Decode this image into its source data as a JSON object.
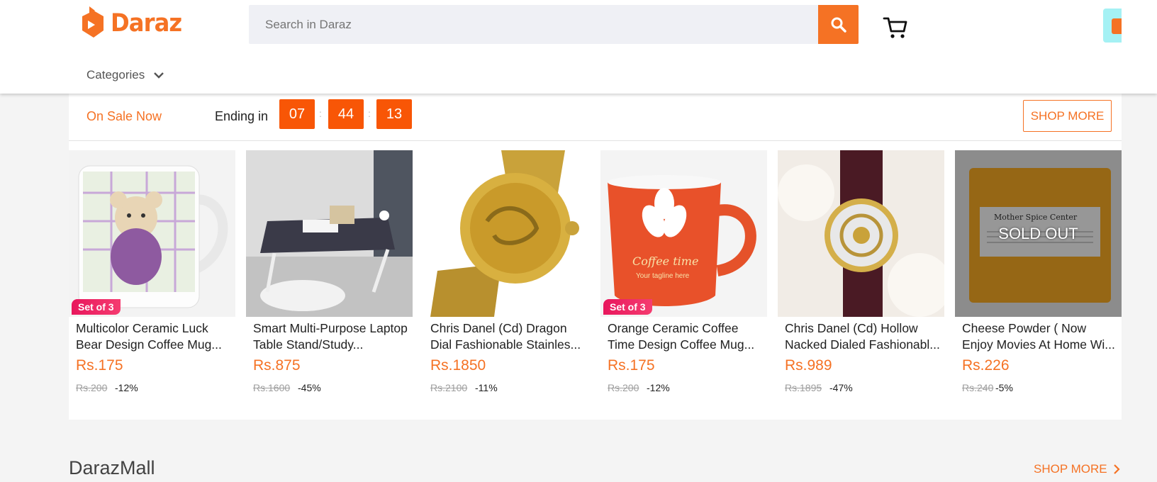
{
  "header": {
    "logo_text": "Daraz",
    "search_placeholder": "Search in Daraz",
    "categories_label": "Categories",
    "brand_color": "#f57224"
  },
  "flash_sale": {
    "on_sale_label": "On Sale Now",
    "ending_label": "Ending in",
    "timer": {
      "hours": "07",
      "minutes": "44",
      "seconds": "13"
    },
    "timer_separator": ":",
    "shop_more_label": "SHOP MORE",
    "products": [
      {
        "name": "Multicolor Ceramic Luck Bear Design Coffee Mug...",
        "price": "Rs.175",
        "original_price": "Rs.200",
        "discount": "-12%",
        "badge": "Set of 3",
        "image_icon": "bear-mug-image"
      },
      {
        "name": "Smart Multi-Purpose Laptop Table Stand/Study...",
        "price": "Rs.875",
        "original_price": "Rs.1600",
        "discount": "-45%",
        "image_icon": "laptop-table-image"
      },
      {
        "name": "Chris Danel (Cd) Dragon Dial Fashionable Stainles...",
        "price": "Rs.1850",
        "original_price": "Rs.2100",
        "discount": "-11%",
        "image_icon": "gold-watch-image"
      },
      {
        "name": "Orange Ceramic Coffee Time Design Coffee Mug...",
        "price": "Rs.175",
        "original_price": "Rs.200",
        "discount": "-12%",
        "badge": "Set of 3",
        "image_icon": "orange-mug-image"
      },
      {
        "name": "Chris Danel (Cd) Hollow Nacked Dialed Fashionabl...",
        "price": "Rs.989",
        "original_price": "Rs.1895",
        "discount": "-47%",
        "image_icon": "leather-watch-image"
      },
      {
        "name": "Cheese Powder ( Now Enjoy Movies At Home Wi...",
        "price": "Rs.226",
        "original_price": "Rs.240",
        "discount": "-5%",
        "sold_out_label": "SOLD OUT",
        "image_icon": "cheese-powder-image",
        "pack_label": "Mother Spice Center"
      }
    ]
  },
  "mall": {
    "title": "DarazMall",
    "shop_more_label": "SHOP MORE"
  }
}
